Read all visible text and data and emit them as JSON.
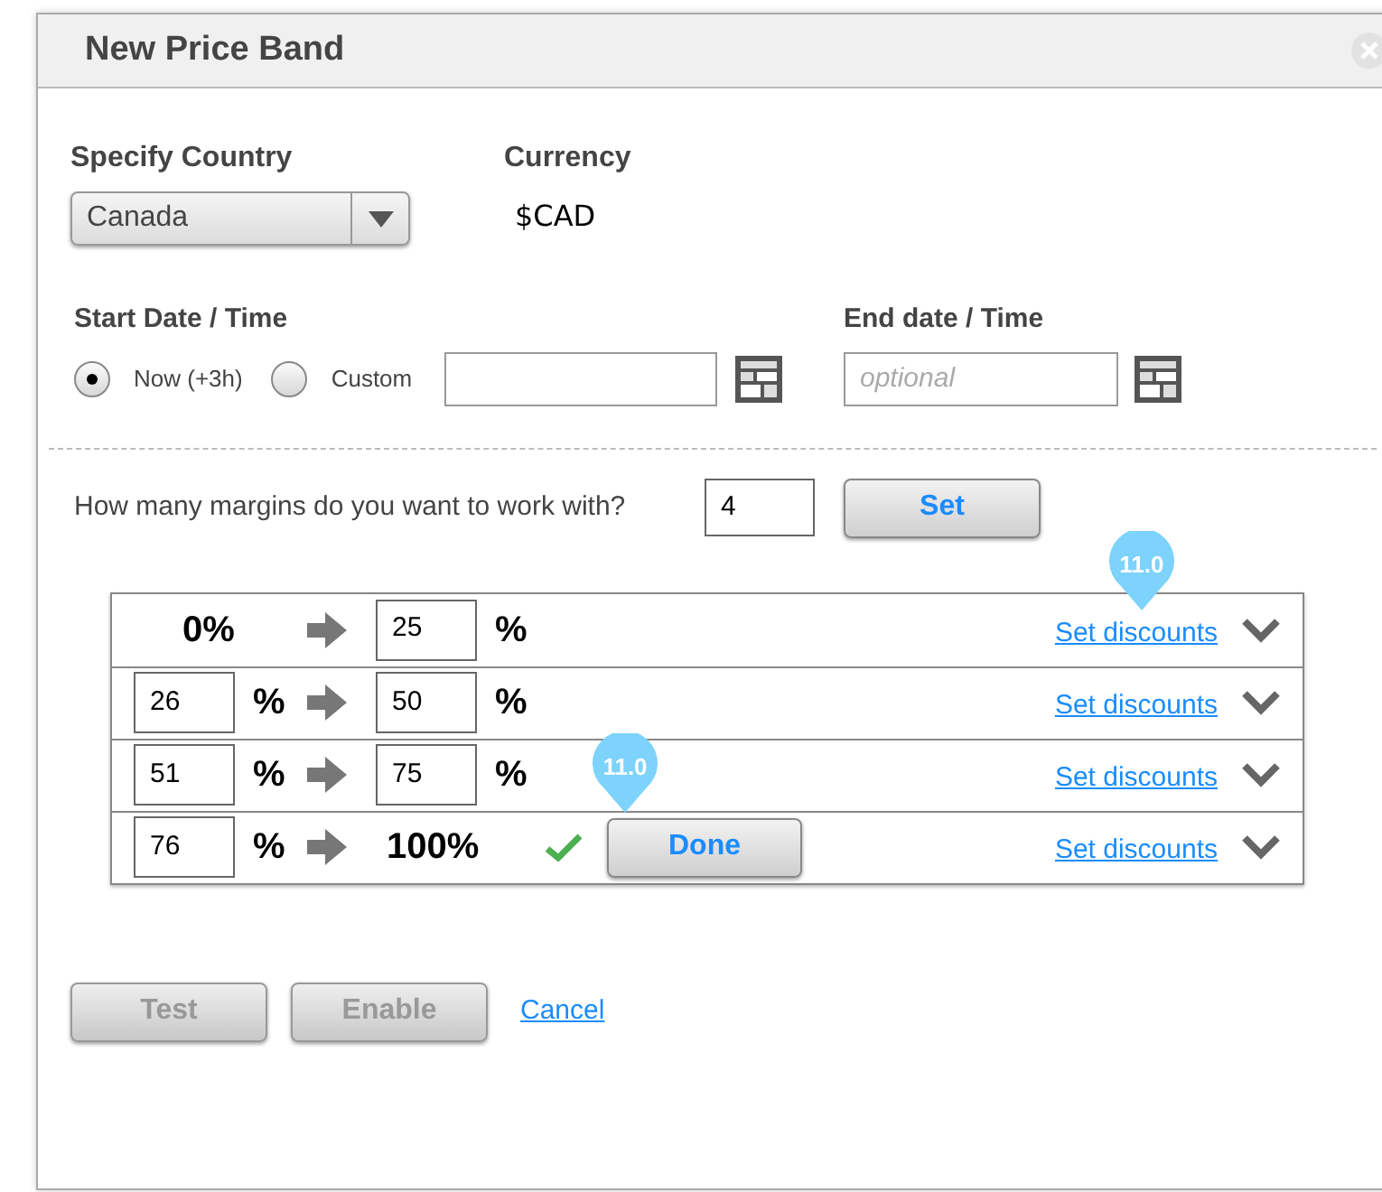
{
  "dialog": {
    "title": "New Price Band",
    "country": {
      "label": "Specify Country",
      "value": "Canada"
    },
    "currency": {
      "label": "Currency",
      "value": "$CAD"
    },
    "start": {
      "label": "Start Date / Time",
      "options": [
        {
          "label": "Now (+3h)",
          "selected": true
        },
        {
          "label": "Custom",
          "selected": false
        }
      ]
    },
    "end": {
      "label": "End date / Time",
      "placeholder": "optional"
    },
    "margins": {
      "question": "How many margins do you want to work with?",
      "value": "4",
      "button": "Set"
    },
    "rows": [
      {
        "from": {
          "kind": "text",
          "value": "0%"
        },
        "to": {
          "kind": "input",
          "value": "25",
          "unit": "%"
        },
        "link": "Set discounts",
        "link_badge": "11.0"
      },
      {
        "from": {
          "kind": "input",
          "value": "26",
          "unit": "%"
        },
        "to": {
          "kind": "input",
          "value": "50",
          "unit": "%"
        },
        "link": "Set discounts"
      },
      {
        "from": {
          "kind": "input",
          "value": "51",
          "unit": "%"
        },
        "to": {
          "kind": "input",
          "value": "75",
          "unit": "%"
        },
        "link": "Set discounts"
      },
      {
        "from": {
          "kind": "input",
          "value": "76",
          "unit": "%"
        },
        "to": {
          "kind": "text",
          "value": "100%"
        },
        "done": {
          "checked": true,
          "label": "Done",
          "badge": "11.0"
        },
        "link": "Set discounts"
      }
    ],
    "actions": [
      {
        "kind": "button",
        "label": "Test",
        "disabled": true
      },
      {
        "kind": "button",
        "label": "Enable",
        "disabled": true
      },
      {
        "kind": "link",
        "label": "Cancel"
      }
    ]
  }
}
